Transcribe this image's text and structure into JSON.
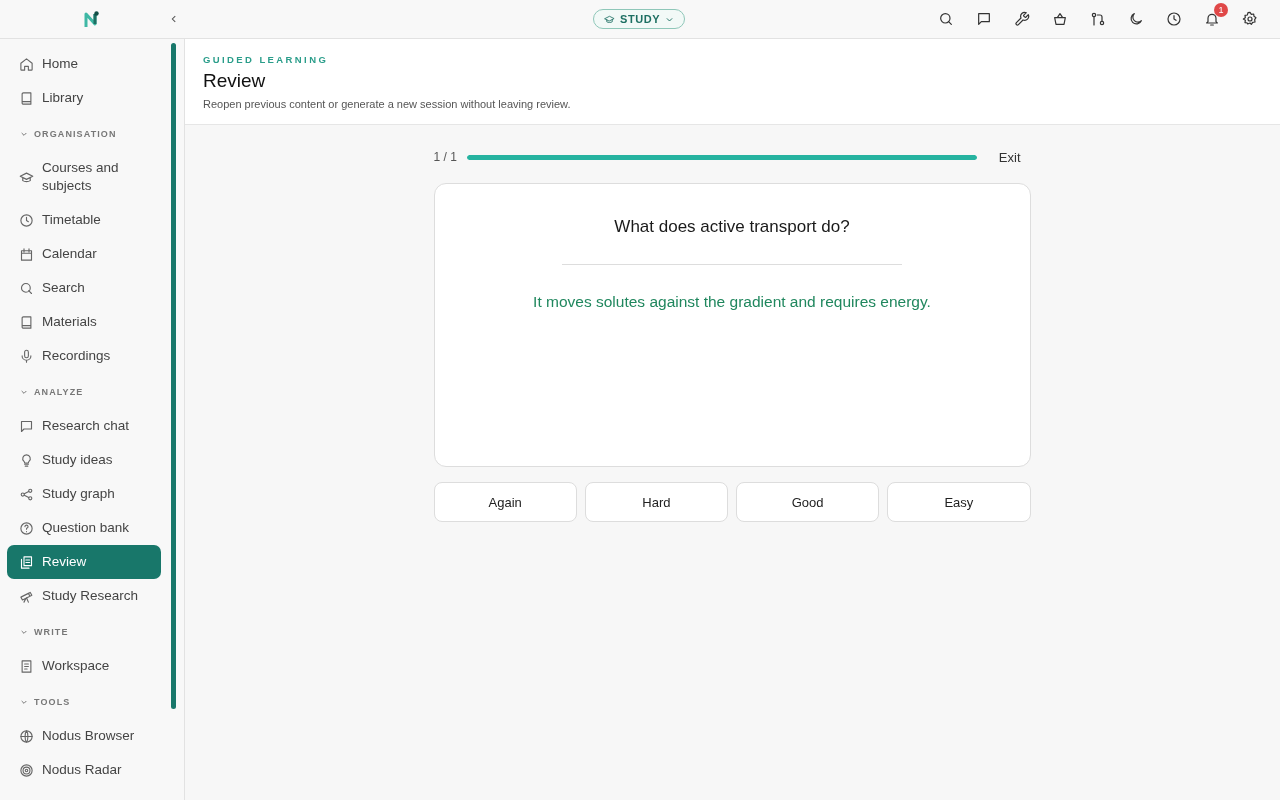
{
  "topbar": {
    "mode_label": "STUDY",
    "notification_count": "1"
  },
  "sidebar": {
    "items": [
      {
        "kind": "item",
        "label": "Home",
        "selected": false
      },
      {
        "kind": "item",
        "label": "Library",
        "selected": false
      },
      {
        "kind": "section",
        "label": "ORGANISATION",
        "expanded": true,
        "children": [
          {
            "label": "Courses and subjects",
            "selected": false
          },
          {
            "label": "Timetable",
            "selected": false
          },
          {
            "label": "Calendar",
            "selected": false
          },
          {
            "label": "Search",
            "selected": false
          },
          {
            "label": "Materials",
            "selected": false
          },
          {
            "label": "Recordings",
            "selected": false
          }
        ]
      },
      {
        "kind": "section",
        "label": "ANALYZE",
        "expanded": true,
        "children": [
          {
            "label": "Research chat",
            "selected": false
          },
          {
            "label": "Study ideas",
            "selected": false
          },
          {
            "label": "Study graph",
            "selected": false
          },
          {
            "label": "Question bank",
            "selected": false
          },
          {
            "label": "Review",
            "selected": true
          },
          {
            "label": "Study Research",
            "selected": false
          }
        ]
      },
      {
        "kind": "section",
        "label": "WRITE",
        "expanded": true,
        "children": [
          {
            "label": "Workspace",
            "selected": false
          }
        ]
      },
      {
        "kind": "section",
        "label": "TOOLS",
        "expanded": true,
        "children": [
          {
            "label": "Nodus Browser",
            "selected": false
          },
          {
            "label": "Nodus Radar",
            "selected": false
          }
        ]
      }
    ]
  },
  "header": {
    "eyebrow": "GUIDED LEARNING",
    "title": "Review",
    "subtitle": "Reopen previous content or generate a new session without leaving review."
  },
  "session": {
    "counter": "1 / 1",
    "level": 1,
    "exit": "Exit",
    "card": {
      "question": "What does active transport do?",
      "answer": "It moves solutes against the gradient and requires energy."
    },
    "ratings": [
      "Again",
      "Hard",
      "Good",
      "Easy"
    ]
  }
}
